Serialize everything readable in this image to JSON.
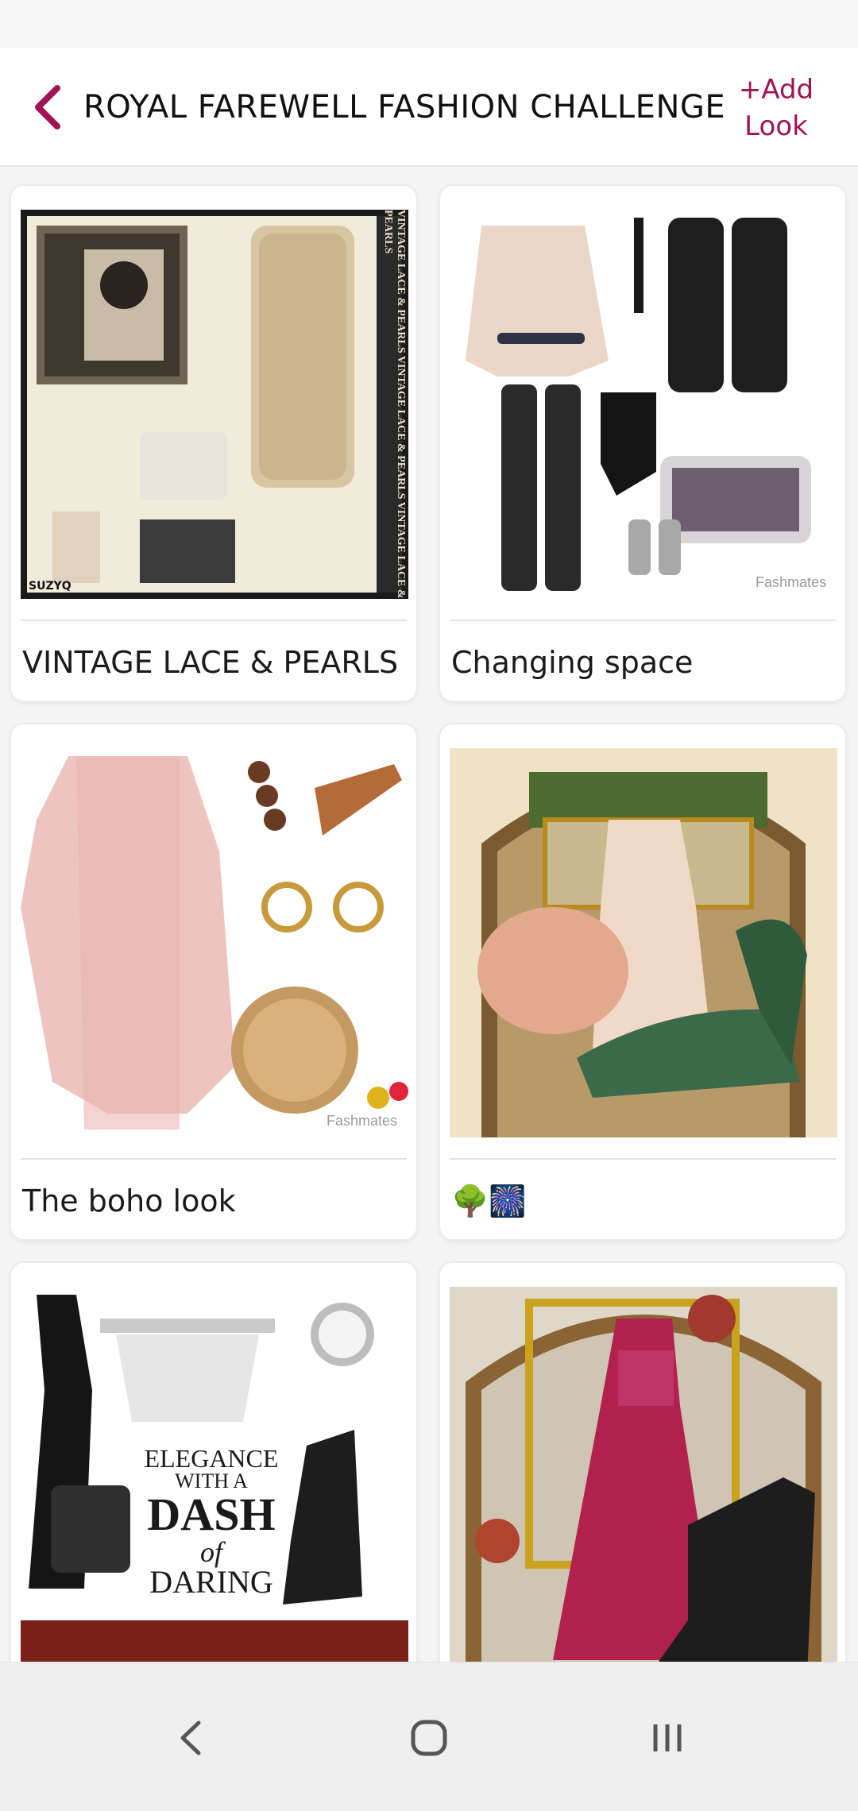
{
  "header": {
    "title": "ROYAL FAREWELL FASHION CHALLENGE",
    "add_look_line1": "+Add",
    "add_look_line2": "Look",
    "accent_color": "#a01454"
  },
  "looks": [
    {
      "caption": "VINTAGE LACE & PEARLS",
      "image_text": "VINTAGE LACE & PEARLS VINTAGE LACE & PEARLS VINTAGE LACE & PEARLS",
      "signature": "SUZYQ"
    },
    {
      "caption": "Changing space",
      "watermark": "Fashmates"
    },
    {
      "caption": "The boho look",
      "watermark": "Fashmates"
    },
    {
      "caption": "🌳🎆"
    },
    {
      "caption": "",
      "image_text": [
        "ELEGANCE",
        "WITH A",
        "DASH",
        "of",
        "DARING"
      ]
    },
    {
      "caption": ""
    }
  ],
  "icons": {
    "back": "chevron-left-icon",
    "nav_back": "nav-back-icon",
    "nav_home": "nav-home-icon",
    "nav_recents": "nav-recents-icon"
  }
}
